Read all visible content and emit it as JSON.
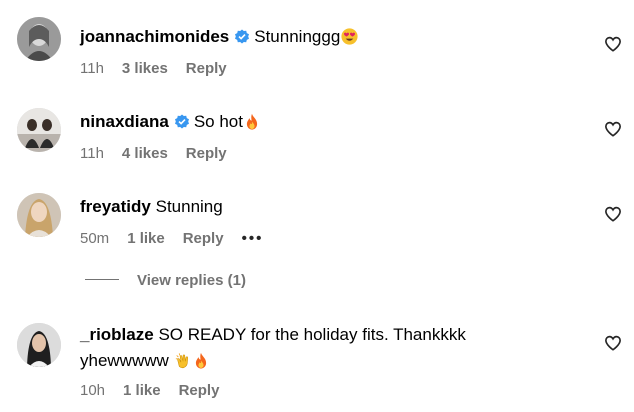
{
  "comments": [
    {
      "username": "joannachimonides",
      "verified": true,
      "text": "Stunninggg",
      "emoji": "heart-eyes-emoji",
      "time": "11h",
      "likes": "3 likes",
      "reply": "Reply"
    },
    {
      "username": "ninaxdiana",
      "verified": true,
      "text": "So hot",
      "emoji": "fire-emoji",
      "time": "11h",
      "likes": "4 likes",
      "reply": "Reply"
    },
    {
      "username": "freyatidy",
      "verified": false,
      "text": "Stunning",
      "time": "50m",
      "likes": "1 like",
      "reply": "Reply",
      "more": "•••",
      "view_replies": "View replies (1)"
    },
    {
      "username": "_rioblaze",
      "verified": false,
      "text_line1": "SO READY for the holiday fits. Thankkkk",
      "text_line2": "yhewwwww",
      "emoji": [
        "clapping-hands-emoji",
        "fire-emoji"
      ],
      "time": "10h",
      "likes": "1 like",
      "reply": "Reply"
    }
  ],
  "colors": {
    "verified_blue": "#3897f0",
    "meta_gray": "#737373",
    "text": "#000000"
  },
  "icons": {
    "like": "heart-outline-icon",
    "verified": "verified-badge-icon"
  }
}
